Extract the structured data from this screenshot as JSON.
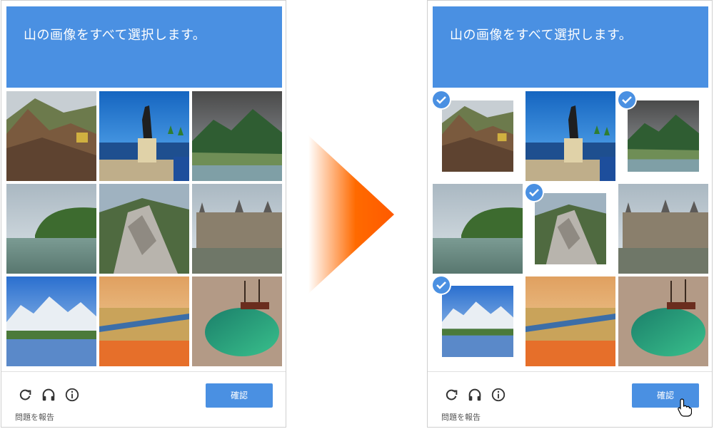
{
  "captcha": {
    "instruction": "山の画像をすべて選択します。",
    "verify_label": "確認",
    "report_label": "問題を報告",
    "icons": [
      "reload-icon",
      "headphones-icon",
      "info-icon"
    ],
    "colors": {
      "accent": "#4a90e2",
      "arrow": "#ff6a00"
    }
  },
  "left_panel": {
    "selected_tiles": []
  },
  "right_panel": {
    "selected_tiles": [
      1,
      3,
      5,
      7
    ]
  },
  "tiles": [
    "dirt-hillside",
    "statue-beach",
    "green-mountains",
    "lake-trees",
    "rocky-ridge",
    "castle-river",
    "snowy-peaks-lake",
    "bridge-marsh",
    "boat-pond"
  ]
}
